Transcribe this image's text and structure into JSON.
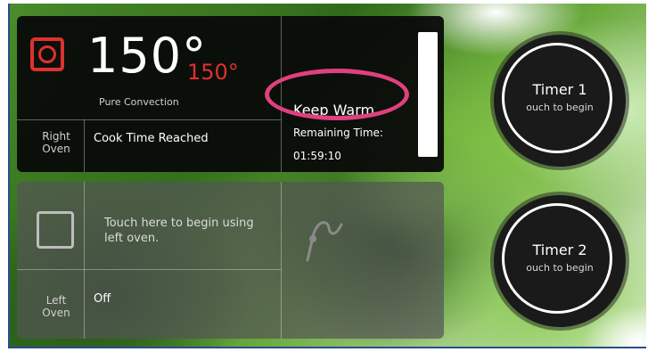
{
  "right_oven": {
    "current_temp": "150°",
    "set_temp": "150°",
    "mode": "Pure Convection",
    "name": [
      "Right",
      "Oven"
    ],
    "status": "Cook Time Reached",
    "keep_warm": "Keep Warm",
    "remaining_label": "Remaining Time:",
    "remaining_time": "01:59:10",
    "progress": 1.0
  },
  "left_oven": {
    "prompt": "Touch here to begin using left oven.",
    "name": [
      "Left",
      "Oven"
    ],
    "status": "Off"
  },
  "timers": [
    {
      "label": "Timer 1",
      "hint": "ouch to begin"
    },
    {
      "label": "Timer 2",
      "hint": "ouch to begin"
    }
  ],
  "icons": {
    "right_power": "power-icon",
    "left_power": "square-icon",
    "probe": "probe-icon"
  },
  "colors": {
    "accent_red": "#e03030",
    "highlight": "#e0407e",
    "panel_dark": "#080808",
    "panel_grey": "#555555"
  }
}
